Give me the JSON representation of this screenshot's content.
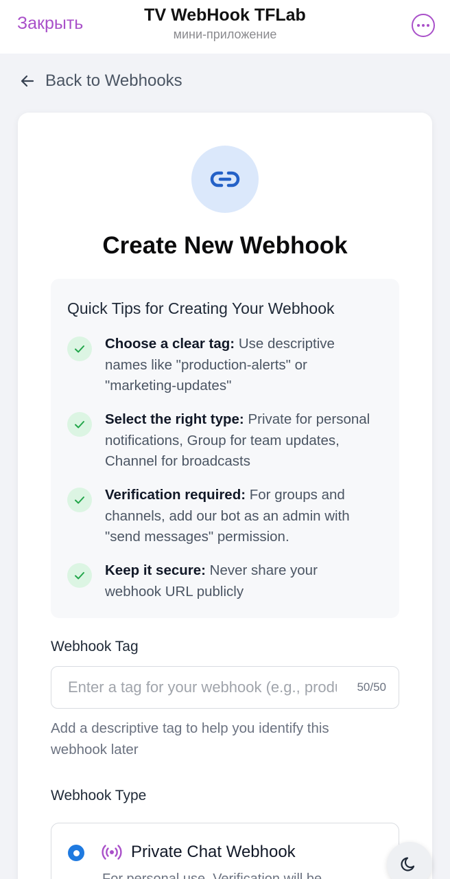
{
  "topbar": {
    "close_label": "Закрыть",
    "title": "TV WebHook TFLab",
    "subtitle": "мини-приложение"
  },
  "back": {
    "label": "Back to Webhooks"
  },
  "page": {
    "title": "Create New Webhook"
  },
  "tips": {
    "title": "Quick Tips for Creating Your Webhook",
    "items": [
      {
        "bold": "Choose a clear tag:",
        "text": " Use descriptive names like \"production-alerts\" or \"marketing-updates\""
      },
      {
        "bold": "Select the right type:",
        "text": " Private for personal notifications, Group for team updates, Channel for broadcasts"
      },
      {
        "bold": "Verification required:",
        "text": " For groups and channels, add our bot as an admin with \"send messages\" permission."
      },
      {
        "bold": "Keep it secure:",
        "text": " Never share your webhook URL publicly"
      }
    ]
  },
  "tag_field": {
    "label": "Webhook Tag",
    "placeholder": "Enter a tag for your webhook (e.g., production-alerts)",
    "value": "",
    "counter": "50/50",
    "help": "Add a descriptive tag to help you identify this webhook later"
  },
  "type_field": {
    "label": "Webhook Type",
    "options": [
      {
        "title": "Private Chat Webhook",
        "description": "For personal use. Verification will be",
        "selected": true
      }
    ]
  },
  "colors": {
    "accent": "#a950c9",
    "primary": "#1f7ae0",
    "check_bg": "#dcf5e3",
    "check": "#22a64a",
    "hero_bg": "#dbe8fb"
  },
  "icons": {
    "hero": "link-icon",
    "back": "arrow-left-icon",
    "more": "more-horizontal-icon",
    "tip": "check-icon",
    "type": "broadcast-icon",
    "theme": "moon-icon"
  }
}
